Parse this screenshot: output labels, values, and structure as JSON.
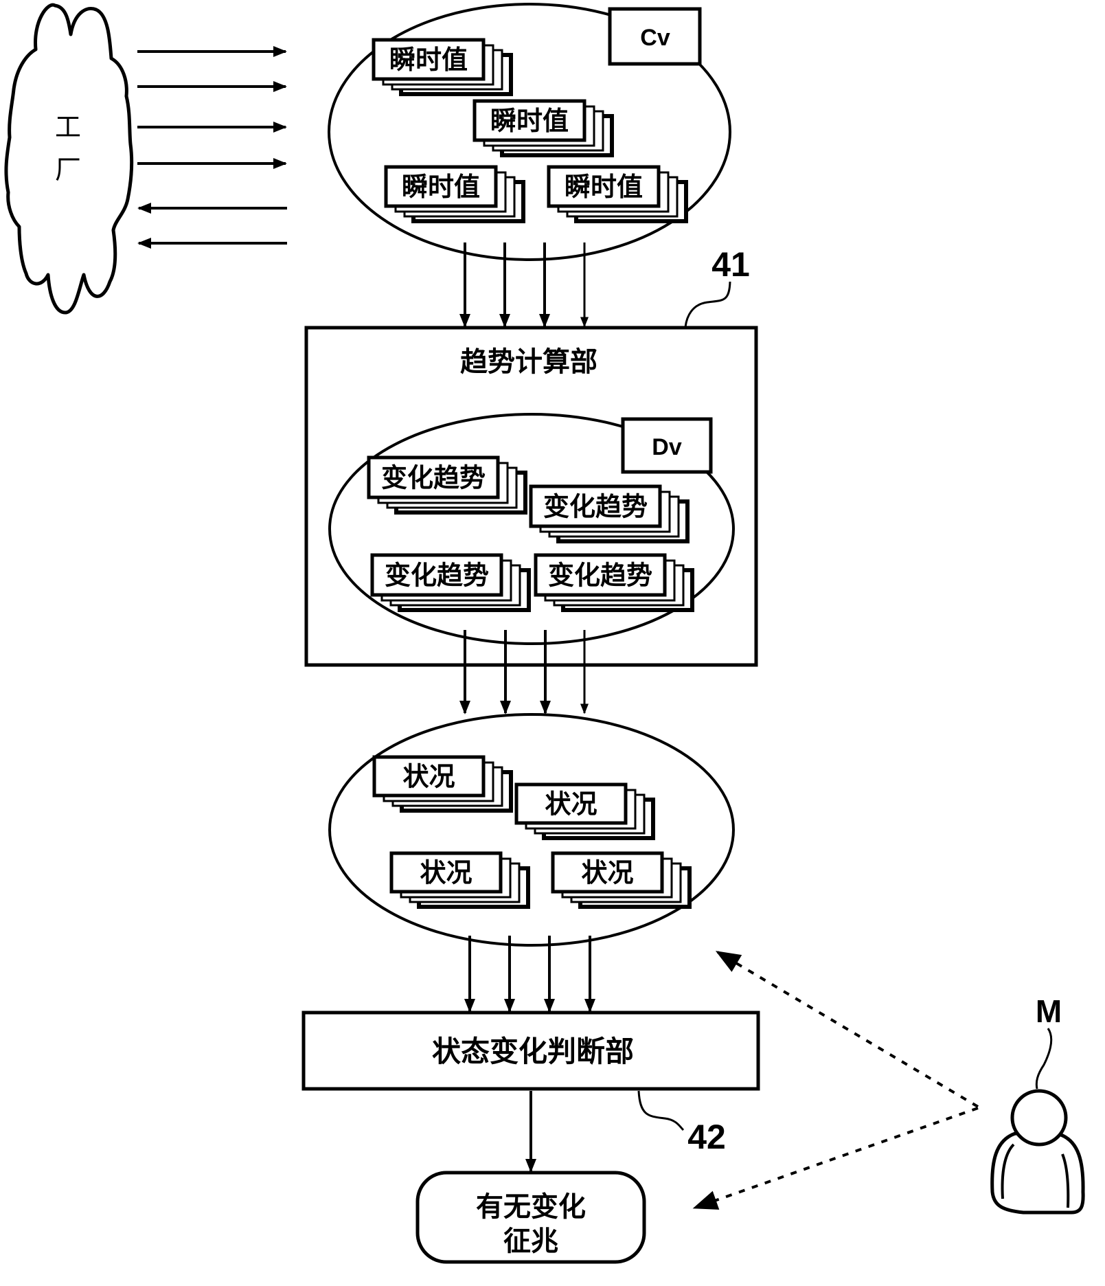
{
  "diagram": {
    "colors": {
      "ink": "#000000",
      "background": "#ffffff"
    },
    "factory": {
      "label": "工厂",
      "label_chars": [
        "工",
        "厂"
      ],
      "inputs_to_factory": 2,
      "outputs_from_factory": 4
    },
    "instant_values": {
      "tag": "Cv",
      "cards": [
        "瞬时值",
        "瞬时值",
        "瞬时值",
        "瞬时值"
      ]
    },
    "trend_calculator": {
      "ref": "41",
      "title": "趋势计算部",
      "tag": "Dv",
      "cards": [
        "变化趋势",
        "变化趋势",
        "变化趋势",
        "变化趋势"
      ]
    },
    "situations": {
      "cards": [
        "状况",
        "状况",
        "状况",
        "状况"
      ]
    },
    "state_change_judge": {
      "ref": "42",
      "title": "状态变化判断部"
    },
    "result": {
      "lines": [
        "有无变化",
        "征兆"
      ]
    },
    "operator": {
      "label": "M",
      "icon": "person-icon"
    }
  }
}
